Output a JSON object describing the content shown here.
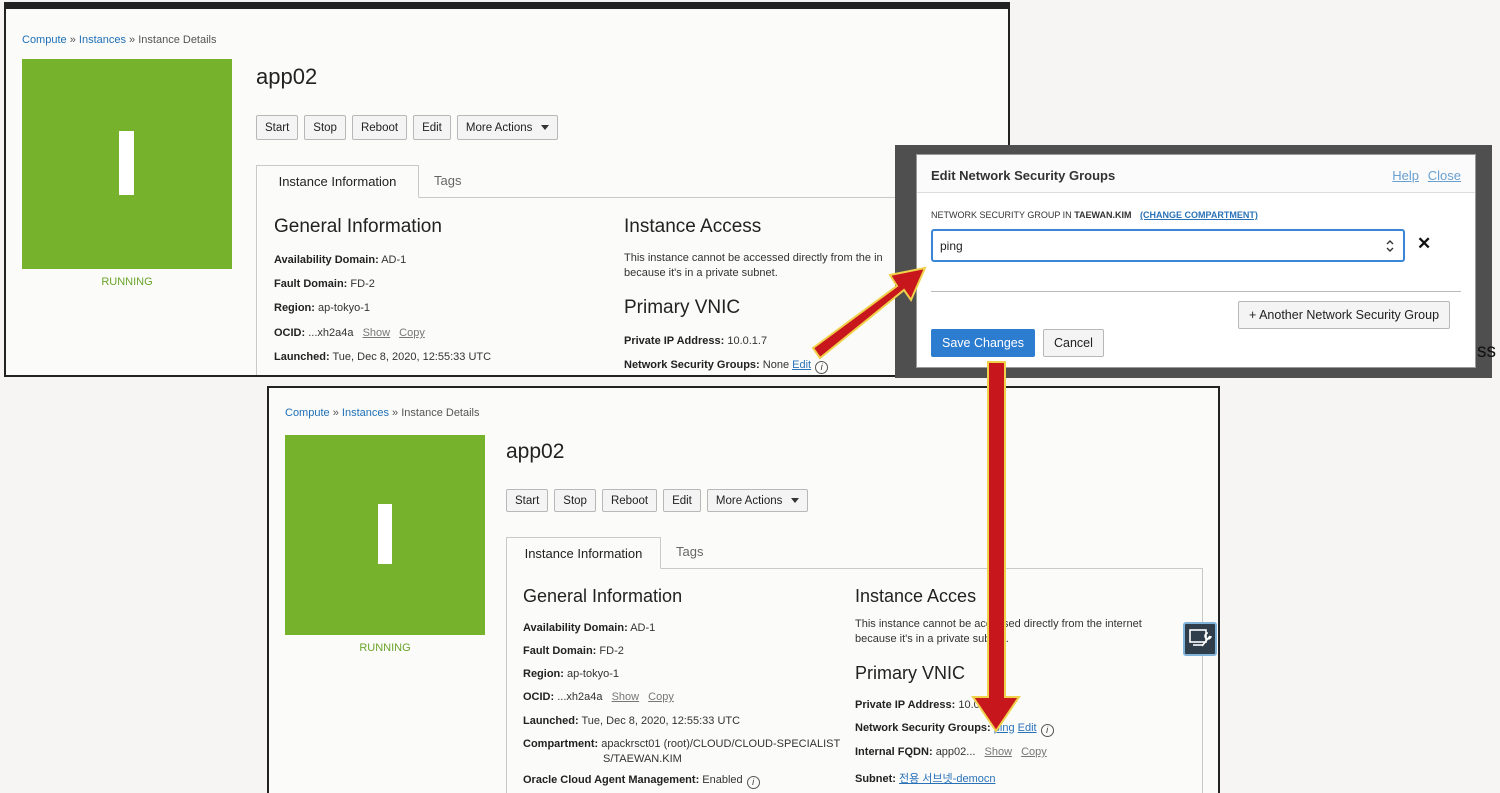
{
  "breadcrumb": {
    "compute": "Compute",
    "sep": "»",
    "instances": "Instances",
    "current": "Instance Details"
  },
  "instance": {
    "tile_letter": "I",
    "status": "RUNNING",
    "name": "app02",
    "buttons": [
      "Start",
      "Stop",
      "Reboot",
      "Edit",
      "More Actions"
    ],
    "tabs": {
      "active": "Instance Information",
      "other": "Tags"
    },
    "general": {
      "heading": "General Information",
      "availability_domain_label": "Availability Domain:",
      "availability_domain": "AD-1",
      "fault_domain_label": "Fault Domain:",
      "fault_domain": "FD-2",
      "region_label": "Region:",
      "region": "ap-tokyo-1",
      "ocid_label": "OCID:",
      "ocid": "...xh2a4a",
      "show": "Show",
      "copy": "Copy",
      "launched_label": "Launched:",
      "launched": "Tue, Dec 8, 2020, 12:55:33 UTC",
      "compartment_label": "Compartment:",
      "compartment_line1": "apackrsct01 (root)/CLOUD/CLOUD-SPECIALIST",
      "compartment_line2": "S/TAEWAN.KIM",
      "agent_label": "Oracle Cloud Agent Management:",
      "agent": "Enabled"
    },
    "access": {
      "heading_top": "Instance Access",
      "heading_bottom": "Instance Acces",
      "text_top_1": "This instance cannot be accessed directly from the in",
      "text_top_2": "because it's in a private subnet.",
      "text_bottom_1": "This instance cannot be accessed directly from the internet",
      "text_bottom_2": "because it's in a private subnet."
    },
    "vnic": {
      "heading": "Primary VNIC",
      "private_ip_label": "Private IP Address:",
      "private_ip_top": "10.0.1.7",
      "private_ip_bottom": "10.0.",
      "nsg_label": "Network Security Groups:",
      "nsg_top": "None",
      "nsg_bottom": "ping",
      "edit": "Edit",
      "fqdn_label": "Internal FQDN:",
      "fqdn": "app02...",
      "subnet_label": "Subnet:",
      "subnet": "전용 서브넷-democn"
    }
  },
  "modal": {
    "title": "Edit Network Security Groups",
    "help": "Help",
    "close": "Close",
    "compartment_label_prefix": "NETWORK SECURITY GROUP IN",
    "compartment_name": "TAEWAN.KIM",
    "change_compartment": "(CHANGE COMPARTMENT)",
    "select_value": "ping",
    "remove_glyph": "✕",
    "add_button": "+ Another Network Security Group",
    "save_button": "Save Changes",
    "cancel_button": "Cancel"
  },
  "colors": {
    "accent": "#2c7cd0",
    "tile": "#77b22c",
    "arrow": "#c8161d",
    "arrow_outline": "#f0d14a"
  }
}
